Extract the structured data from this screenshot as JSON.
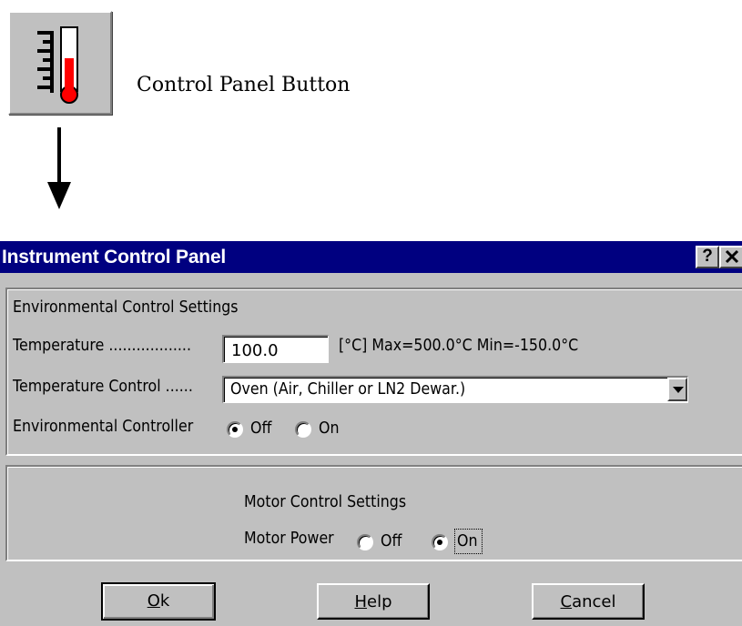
{
  "control_panel_button": {
    "caption": "Control Panel Button",
    "icon": "thermometer-scale-icon"
  },
  "dialog": {
    "title": "Instrument Control Panel",
    "title_buttons": {
      "help": "?",
      "close": "✕"
    },
    "environment": {
      "heading": "Environmental Control Settings",
      "temperature_label": "Temperature ..................",
      "temperature_value": "100.0",
      "temperature_range": "[°C] Max=500.0°C  Min=-150.0°C",
      "temp_control_label": "Temperature Control ......",
      "temp_control_value": "Oven (Air, Chiller or LN2 Dewar.)",
      "controller_label": "Environmental Controller",
      "controller_options": [
        "Off",
        "On"
      ],
      "controller_selected": "Off"
    },
    "motor": {
      "heading": "Motor Control Settings",
      "power_label": "Motor Power",
      "power_options": [
        "Off",
        "On"
      ],
      "power_selected": "On"
    },
    "buttons": {
      "ok": {
        "mnemonic": "O",
        "rest": "k"
      },
      "help": {
        "mnemonic": "H",
        "rest": "elp"
      },
      "cancel": {
        "mnemonic": "C",
        "rest": "ancel"
      }
    }
  },
  "colors": {
    "titlebar": "#000080",
    "face": "#c0c0c0",
    "thermometer_red": "#ff0000"
  }
}
